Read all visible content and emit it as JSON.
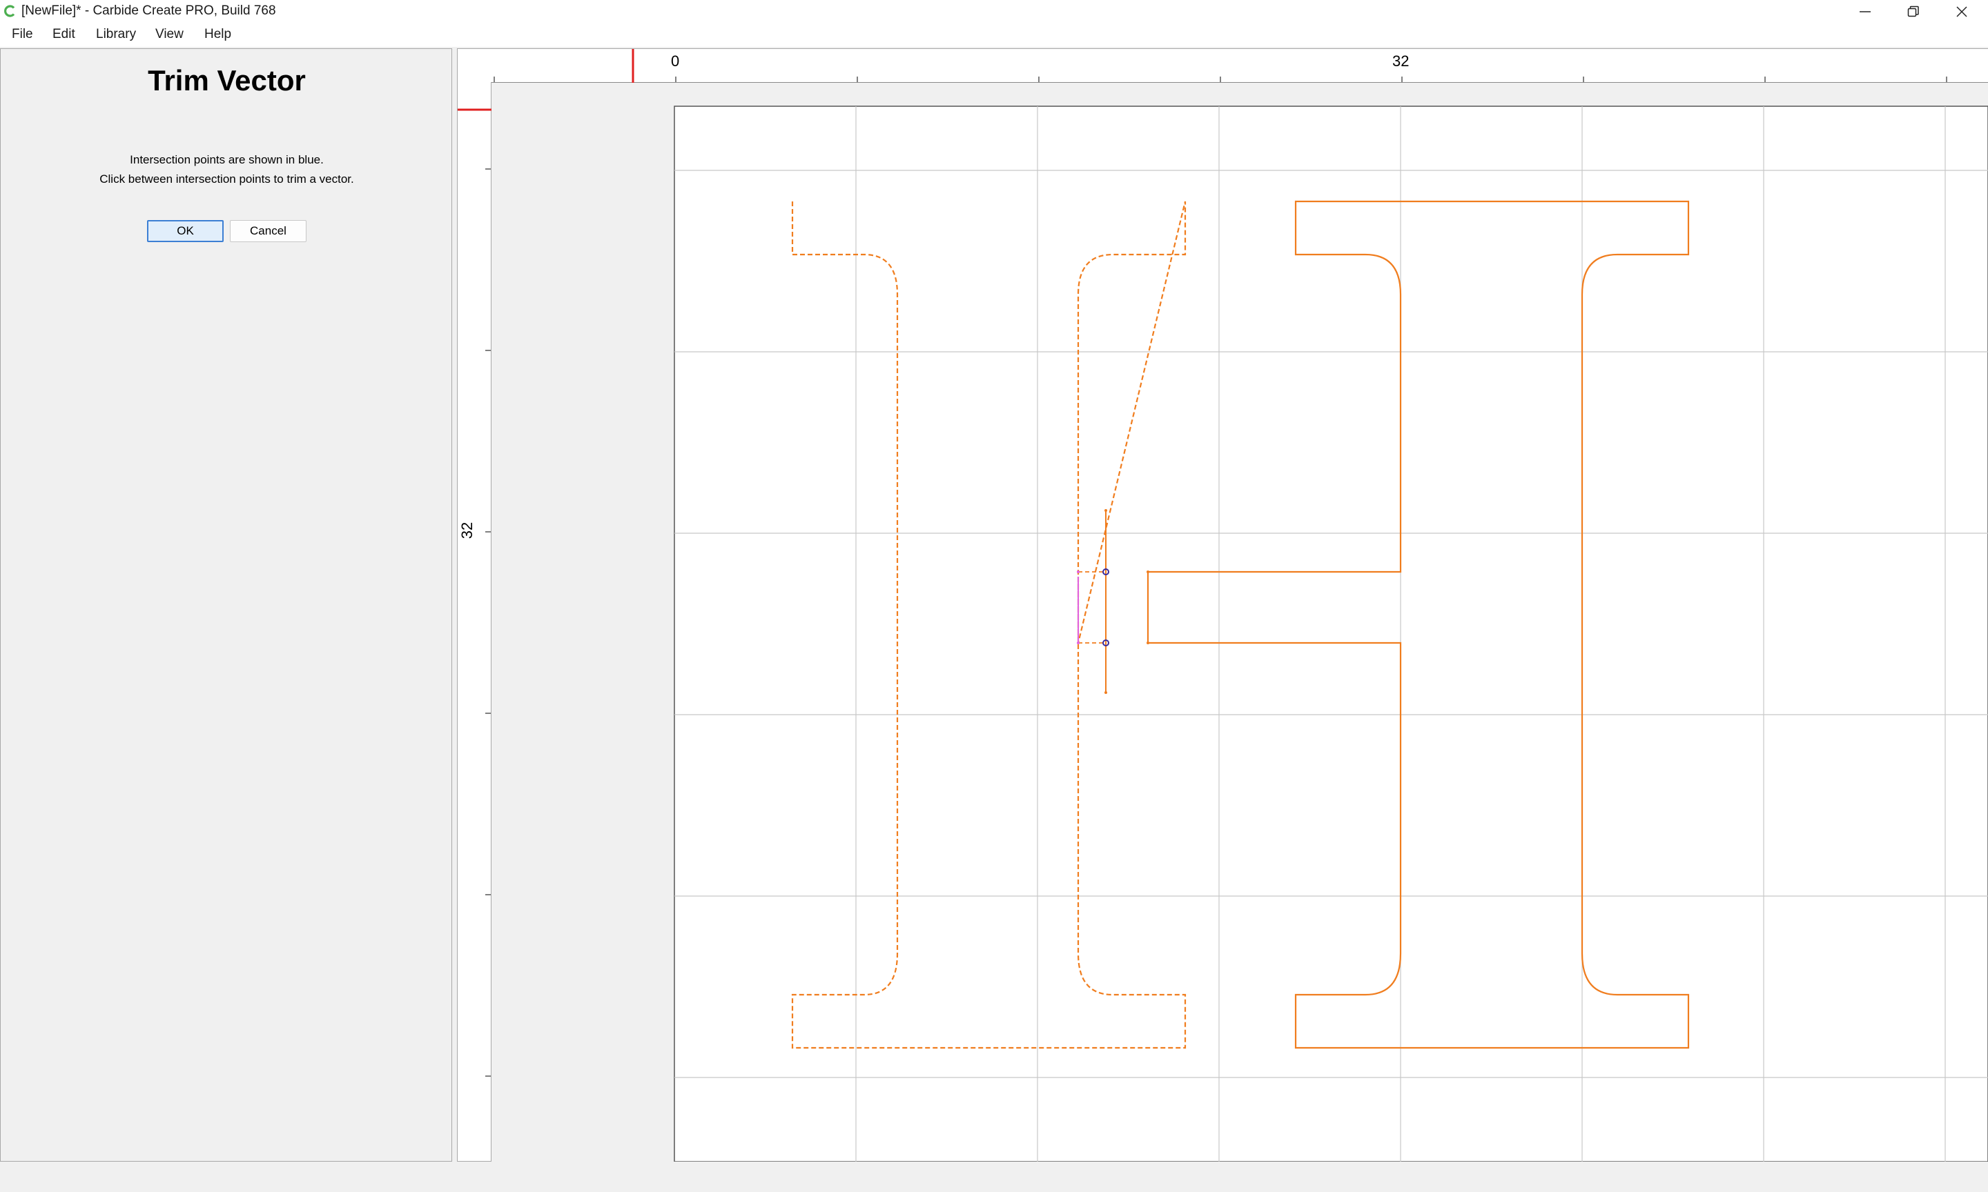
{
  "window": {
    "title": "[NewFile]* - Carbide Create PRO, Build 768"
  },
  "menu": {
    "items": [
      "File",
      "Edit",
      "Library",
      "View",
      "Help"
    ]
  },
  "panel": {
    "title": "Trim Vector",
    "info_line_1": "Intersection points are shown in blue.",
    "info_line_2": "Click between intersection points to trim a vector.",
    "ok_label": "OK",
    "cancel_label": "Cancel"
  },
  "rulers": {
    "top_labels": [
      "0",
      "32"
    ],
    "left_labels": [
      "32"
    ]
  },
  "colors": {
    "vector": "#f07d1e",
    "trim_segment": "#e060e0",
    "intersection": "#3a2a9a",
    "grid": "#c8c8c8",
    "ruler_marker": "#e02020",
    "ok_accent": "#3c7fd4"
  },
  "icons": {
    "app": "carbide-create-c-icon",
    "minimize": "minimize-icon",
    "restore": "restore-icon",
    "close": "close-icon"
  }
}
